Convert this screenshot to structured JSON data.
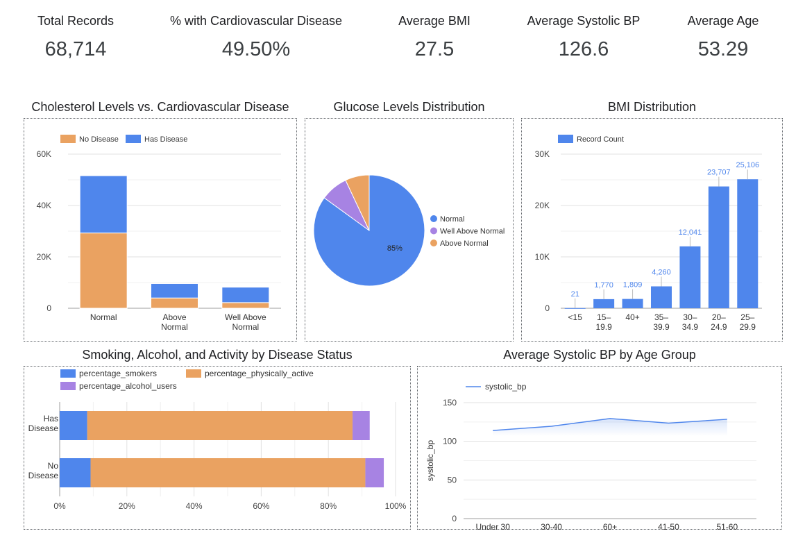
{
  "kpis": [
    {
      "label": "Total Records",
      "value": "68,714"
    },
    {
      "label": "% with Cardiovascular Disease",
      "value": "49.50%"
    },
    {
      "label": "Average BMI",
      "value": "27.5"
    },
    {
      "label": "Average Systolic BP",
      "value": "126.6"
    },
    {
      "label": "Average Age",
      "value": "53.29"
    }
  ],
  "titles": {
    "cholesterol": "Cholesterol Levels vs. Cardiovascular Disease",
    "glucose": "Glucose Levels Distribution",
    "bmi": "BMI Distribution",
    "lifestyle": "Smoking, Alcohol, and Activity by Disease Status",
    "systolic": "Average Systolic BP by Age Group"
  },
  "colors": {
    "blue": "#4f86ec",
    "orange": "#eaa261",
    "purple": "#a783e3",
    "grid": "#e0e0e0",
    "axis_text": "#444444",
    "data_label": "#4f86ec"
  },
  "chart_data": [
    {
      "id": "cholesterol",
      "type": "bar",
      "stacked": true,
      "title": "Cholesterol Levels vs. Cardiovascular Disease",
      "categories": [
        "Normal",
        "Above Normal",
        "Well Above Normal"
      ],
      "series": [
        {
          "name": "No Disease",
          "values": [
            29300,
            4000,
            2200
          ],
          "color": "#eaa261"
        },
        {
          "name": "Has Disease",
          "values": [
            22300,
            5600,
            6000
          ],
          "color": "#4f86ec"
        }
      ],
      "ylim": [
        0,
        60000
      ],
      "yticks": [
        "0",
        "20K",
        "40K",
        "60K"
      ],
      "legend": "top-left",
      "grid": true
    },
    {
      "id": "glucose",
      "type": "pie",
      "title": "Glucose Levels Distribution",
      "labels": [
        "Normal",
        "Well Above Normal",
        "Above Normal"
      ],
      "values": [
        85,
        8,
        7
      ],
      "colors": [
        "#4f86ec",
        "#a783e3",
        "#eaa261"
      ],
      "slice_labels": [
        "85%",
        "",
        ""
      ],
      "legend": "right"
    },
    {
      "id": "bmi",
      "type": "bar",
      "title": "BMI Distribution",
      "categories": [
        "<15",
        "15–19.9",
        "40+",
        "35–39.9",
        "30–34.9",
        "20–24.9",
        "25–29.9"
      ],
      "series": [
        {
          "name": "Record Count",
          "values": [
            21,
            1770,
            1809,
            4260,
            12041,
            23707,
            25106
          ],
          "color": "#4f86ec"
        }
      ],
      "data_labels": [
        "21",
        "1,770",
        "1,809",
        "4,260",
        "12,041",
        "23,707",
        "25,106"
      ],
      "ylim": [
        0,
        30000
      ],
      "yticks": [
        "0",
        "10K",
        "20K",
        "30K"
      ],
      "legend": "top-left",
      "grid": true
    },
    {
      "id": "lifestyle",
      "type": "bar",
      "orientation": "horizontal",
      "stacked": true,
      "title": "Smoking, Alcohol, and Activity by Disease Status",
      "categories": [
        "Has Disease",
        "No Disease"
      ],
      "series": [
        {
          "name": "percentage_smokers",
          "values": [
            8.2,
            9.2
          ],
          "color": "#4f86ec"
        },
        {
          "name": "percentage_physically_active",
          "values": [
            79.0,
            81.8
          ],
          "color": "#eaa261"
        },
        {
          "name": "percentage_alcohol_users",
          "values": [
            5.1,
            5.5
          ],
          "color": "#a783e3"
        }
      ],
      "xlim": [
        0,
        100
      ],
      "xticks": [
        "0%",
        "20%",
        "40%",
        "60%",
        "80%",
        "100%"
      ],
      "legend": "top",
      "grid": true
    },
    {
      "id": "systolic",
      "type": "line",
      "title": "Average Systolic BP by Age Group",
      "categories": [
        "Under 30",
        "30-40",
        "60+",
        "41-50",
        "51-60"
      ],
      "series": [
        {
          "name": "systolic_bp",
          "values": [
            114,
            119.5,
            129.5,
            123.5,
            128.5
          ],
          "color": "#4f86ec"
        }
      ],
      "ylabel": "systolic_bp",
      "ylim": [
        0,
        150
      ],
      "yticks": [
        "0",
        "50",
        "100",
        "150"
      ],
      "legend": "top-left",
      "grid": true
    }
  ]
}
